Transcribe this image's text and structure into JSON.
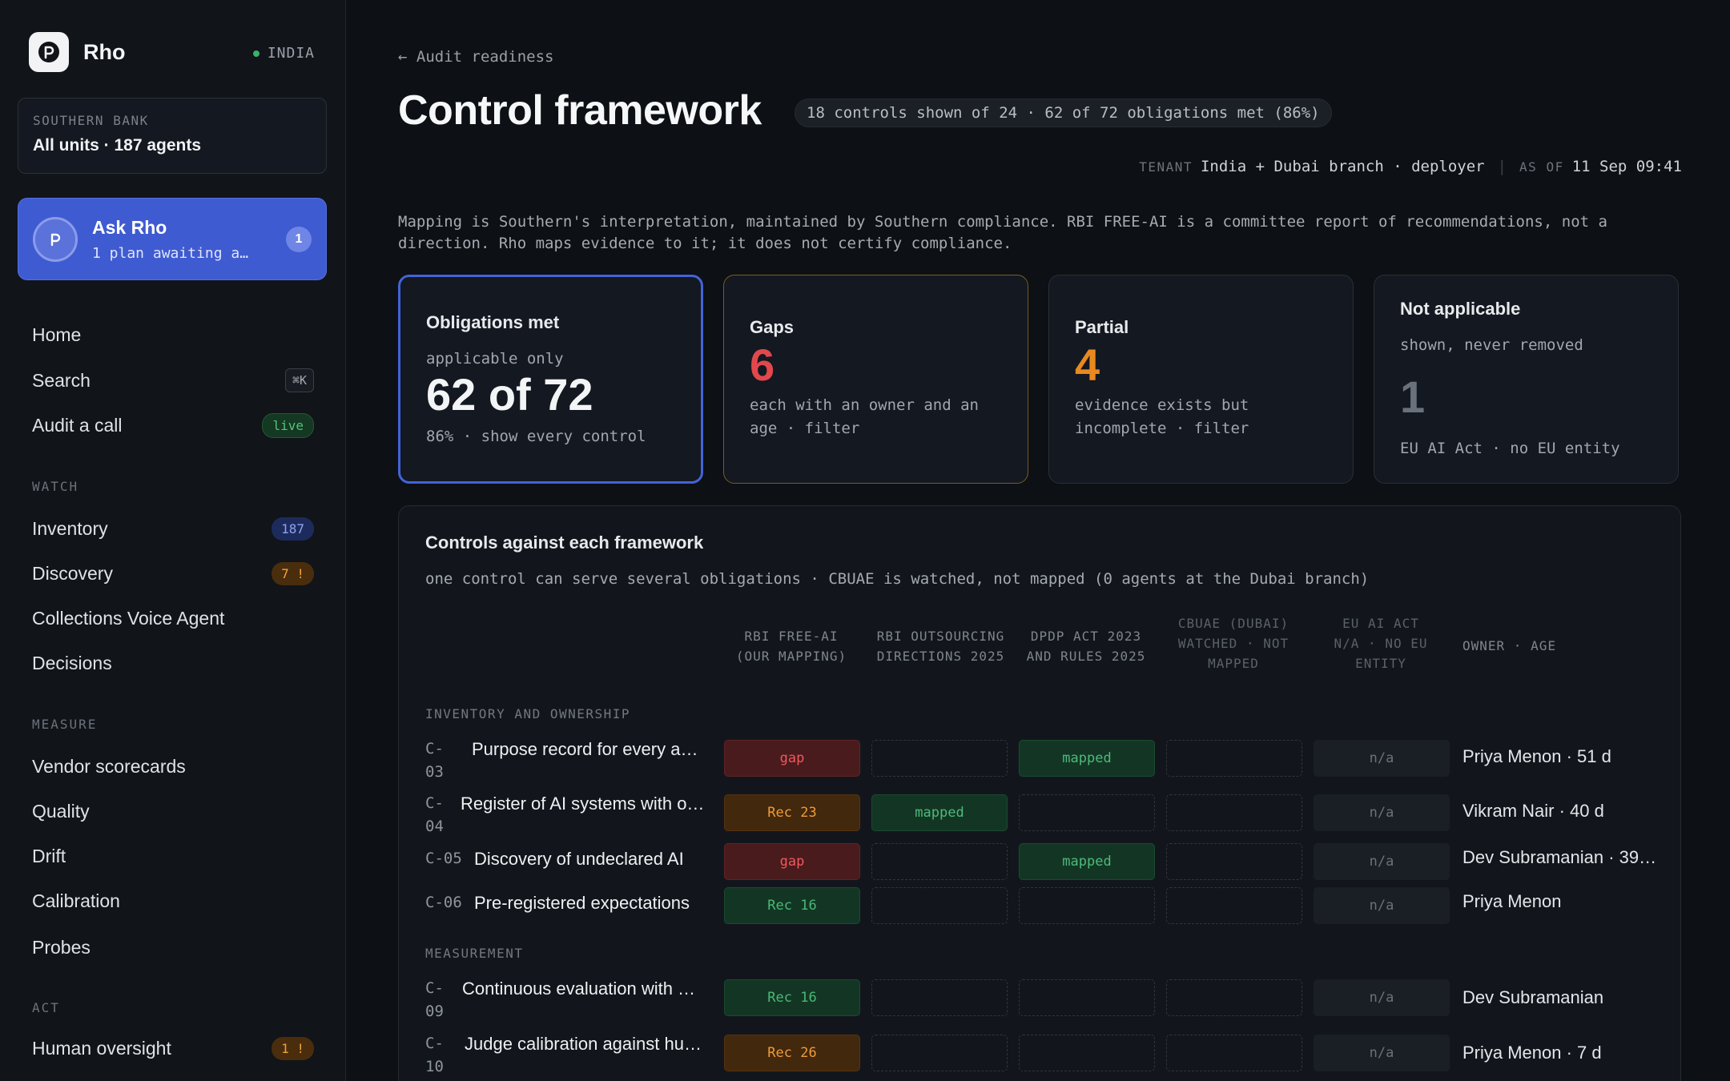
{
  "app": {
    "name": "Rho",
    "region": "INDIA"
  },
  "tenant": {
    "kicker": "SOUTHERN BANK",
    "value": "All units · 187 agents"
  },
  "ask": {
    "title": "Ask Rho",
    "subtitle": "1 plan awaiting a…",
    "badge": "1"
  },
  "nav": {
    "home": "Home",
    "search": "Search",
    "search_kbd": "⌘K",
    "audit": "Audit a call",
    "audit_pill": "live",
    "watch_label": "WATCH",
    "inventory": "Inventory",
    "inventory_count": "187",
    "discovery": "Discovery",
    "discovery_count": "7 !",
    "collections": "Collections Voice Agent",
    "decisions": "Decisions",
    "measure_label": "MEASURE",
    "vendor": "Vendor scorecards",
    "quality": "Quality",
    "drift": "Drift",
    "calibration": "Calibration",
    "probes": "Probes",
    "act_label": "ACT",
    "oversight": "Human oversight",
    "oversight_count": "1 !"
  },
  "page": {
    "back": "← Audit readiness",
    "title": "Control framework",
    "summary": "18 controls shown of 24 · 62 of 72 obligations met (86%)",
    "tenant_key": "TENANT",
    "tenant_value": "India + Dubai branch · deployer",
    "asof_key": "AS OF",
    "asof_value": "11 Sep 09:41",
    "disclaimer": "Mapping is Southern's interpretation, maintained by Southern compliance. RBI FREE-AI is a committee report of recommendations, not a direction. Rho maps evidence to it; it does not certify compliance."
  },
  "cards": {
    "met": {
      "title": "Obligations met",
      "kicker": "applicable only",
      "big": "62 of 72",
      "sub": "86% · show every control"
    },
    "gaps": {
      "title": "Gaps",
      "big": "6",
      "sub": "each with an owner and an age · filter"
    },
    "partial": {
      "title": "Partial",
      "big": "4",
      "sub": "evidence exists but incomplete · filter"
    },
    "na": {
      "title": "Not applicable",
      "kicker": "shown, never removed",
      "big": "1",
      "sub": "EU AI Act · no EU entity"
    }
  },
  "panel": {
    "title": "Controls against each framework",
    "subtitle": "one control can serve several obligations · CBUAE is watched, not mapped (0 agents at the Dubai branch)",
    "columns": {
      "rbi_free": "RBI FREE-AI\n(OUR MAPPING)",
      "rbi_out": "RBI OUTSOURCING\nDIRECTIONS 2025",
      "dpdp": "DPDP ACT 2023\nAND RULES 2025",
      "cbuae": "CBUAE (DUBAI)\nWATCHED · NOT\nMAPPED",
      "euai": "EU AI ACT\nN/A · NO EU\nENTITY",
      "owner": "OWNER · AGE"
    },
    "groups": {
      "inventory": "INVENTORY AND OWNERSHIP",
      "measurement": "MEASUREMENT"
    },
    "rows": [
      {
        "id": "C-\n03",
        "name": "Purpose record for every a…",
        "c1": "gap",
        "c3": "mapped",
        "c5": "n/a",
        "owner": "Priya Menon · 51 d"
      },
      {
        "id": "C-\n04",
        "name": "Register of AI systems with o…",
        "c1": "Rec 23",
        "c2": "mapped",
        "c5": "n/a",
        "owner": "Vikram Nair · 40 d"
      },
      {
        "id": "C-05",
        "name": "Discovery of undeclared AI",
        "c1": "gap",
        "c3": "mapped",
        "c5": "n/a",
        "owner": "Dev Subramanian · 39…"
      },
      {
        "id": "C-06",
        "name": "Pre-registered expectations",
        "c1": "Rec 16",
        "c5": "n/a",
        "owner": "Priya Menon"
      },
      {
        "id": "C-\n09",
        "name": "Continuous evaluation with …",
        "c1": "Rec 16",
        "c5": "n/a",
        "owner": "Dev Subramanian"
      },
      {
        "id": "C-\n10",
        "name": "Judge calibration against hu…",
        "c1": "Rec 26",
        "c5": "n/a",
        "owner": "Priya Menon · 7 d"
      }
    ]
  },
  "colors": {
    "accent": "#3f5bd1",
    "gap": "#e0484c",
    "partial": "#e8891f",
    "ok": "#38b26a"
  }
}
